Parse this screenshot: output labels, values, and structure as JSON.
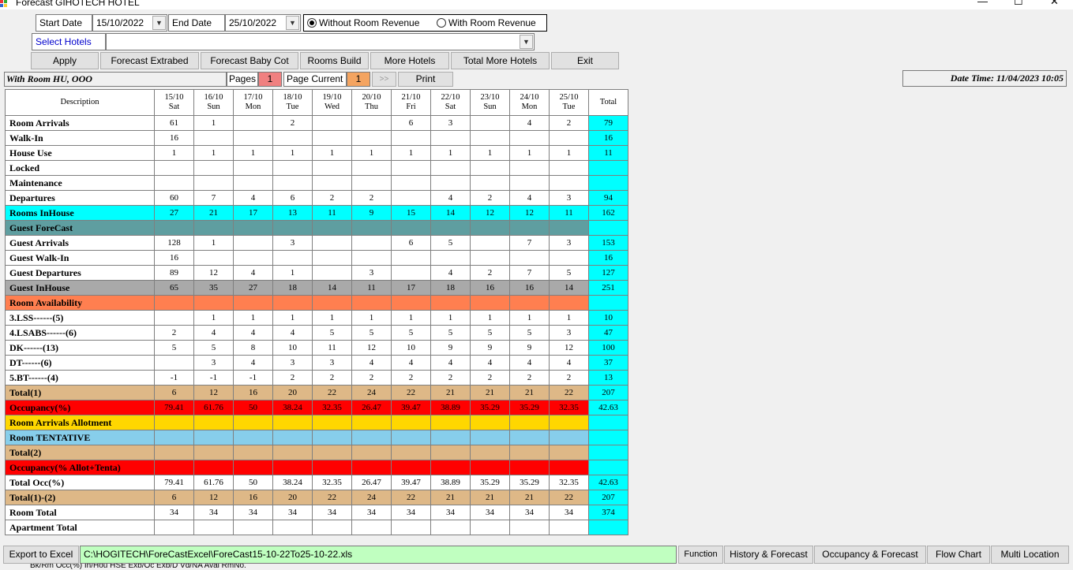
{
  "window": {
    "title": "Forecast GIHOTECH HOTEL",
    "minimize": "—",
    "maximize": "☐",
    "close": "✕"
  },
  "filters": {
    "start_label": "Start Date",
    "start_value": "15/10/2022",
    "end_label": "End Date",
    "end_value": "25/10/2022",
    "radio_without": "Without Room Revenue",
    "radio_with": "With Room Revenue",
    "select_hotels_label": "Select Hotels",
    "select_hotels_value": ""
  },
  "buttons": {
    "apply": "Apply",
    "forecast_extrabed": "Forecast Extrabed",
    "forecast_babycot": "Forecast Baby Cot",
    "rooms_build": "Rooms Build",
    "more_hotels": "More Hotels",
    "total_more_hotels": "Total More Hotels",
    "exit": "Exit"
  },
  "infobar": {
    "mode": "With Room HU, OOO",
    "pages_label": "Pages",
    "pages_value": "1",
    "page_current_label": "Page Current",
    "page_current_value": "1",
    "next": ">>",
    "print": "Print",
    "datetime": "Date Time: 11/04/2023 10:05"
  },
  "table": {
    "desc_header": "Description",
    "columns": [
      {
        "date": "15/10",
        "day": "Sat"
      },
      {
        "date": "16/10",
        "day": "Sun"
      },
      {
        "date": "17/10",
        "day": "Mon"
      },
      {
        "date": "18/10",
        "day": "Tue"
      },
      {
        "date": "19/10",
        "day": "Wed"
      },
      {
        "date": "20/10",
        "day": "Thu"
      },
      {
        "date": "21/10",
        "day": "Fri"
      },
      {
        "date": "22/10",
        "day": "Sat"
      },
      {
        "date": "23/10",
        "day": "Sun"
      },
      {
        "date": "24/10",
        "day": "Mon"
      },
      {
        "date": "25/10",
        "day": "Tue"
      }
    ],
    "total_header": "Total",
    "rows": [
      {
        "label": "Room Arrivals",
        "style": "",
        "values": [
          "61",
          "1",
          "",
          "2",
          "",
          "",
          "6",
          "3",
          "",
          "4",
          "2"
        ],
        "total": "79"
      },
      {
        "label": "Walk-In",
        "style": "",
        "values": [
          "16",
          "",
          "",
          "",
          "",
          "",
          "",
          "",
          "",
          "",
          ""
        ],
        "total": "16"
      },
      {
        "label": "House Use",
        "style": "",
        "values": [
          "1",
          "1",
          "1",
          "1",
          "1",
          "1",
          "1",
          "1",
          "1",
          "1",
          "1"
        ],
        "total": "11"
      },
      {
        "label": "Locked",
        "style": "",
        "values": [
          "",
          "",
          "",
          "",
          "",
          "",
          "",
          "",
          "",
          "",
          ""
        ],
        "total": ""
      },
      {
        "label": "Maintenance",
        "style": "",
        "values": [
          "",
          "",
          "",
          "",
          "",
          "",
          "",
          "",
          "",
          "",
          ""
        ],
        "total": ""
      },
      {
        "label": "Departures",
        "style": "",
        "values": [
          "60",
          "7",
          "4",
          "6",
          "2",
          "2",
          "",
          "4",
          "2",
          "4",
          "3"
        ],
        "total": "94"
      },
      {
        "label": "Rooms InHouse",
        "style": "cyan",
        "values": [
          "27",
          "21",
          "17",
          "13",
          "11",
          "9",
          "15",
          "14",
          "12",
          "12",
          "11"
        ],
        "total": "162"
      },
      {
        "label": "Guest ForeCast",
        "style": "teal",
        "values": [
          "",
          "",
          "",
          "",
          "",
          "",
          "",
          "",
          "",
          "",
          ""
        ],
        "total": ""
      },
      {
        "label": "Guest Arrivals",
        "style": "",
        "values": [
          "128",
          "1",
          "",
          "3",
          "",
          "",
          "6",
          "5",
          "",
          "7",
          "3"
        ],
        "total": "153"
      },
      {
        "label": "Guest Walk-In",
        "style": "",
        "values": [
          "16",
          "",
          "",
          "",
          "",
          "",
          "",
          "",
          "",
          "",
          ""
        ],
        "total": "16"
      },
      {
        "label": "Guest Departures",
        "style": "",
        "values": [
          "89",
          "12",
          "4",
          "1",
          "",
          "3",
          "",
          "4",
          "2",
          "7",
          "5"
        ],
        "total": "127"
      },
      {
        "label": "Guest InHouse",
        "style": "gray",
        "values": [
          "65",
          "35",
          "27",
          "18",
          "14",
          "11",
          "17",
          "18",
          "16",
          "16",
          "14"
        ],
        "total": "251"
      },
      {
        "label": "Room Availability",
        "style": "coral",
        "values": [
          "",
          "",
          "",
          "",
          "",
          "",
          "",
          "",
          "",
          "",
          ""
        ],
        "total": ""
      },
      {
        "label": "3.LSS------(5)",
        "style": "",
        "values": [
          "",
          "1",
          "1",
          "1",
          "1",
          "1",
          "1",
          "1",
          "1",
          "1",
          "1"
        ],
        "total": "10"
      },
      {
        "label": "4.LSABS------(6)",
        "style": "",
        "values": [
          "2",
          "4",
          "4",
          "4",
          "5",
          "5",
          "5",
          "5",
          "5",
          "5",
          "3"
        ],
        "total": "47"
      },
      {
        "label": "DK------(13)",
        "style": "",
        "values": [
          "5",
          "5",
          "8",
          "10",
          "11",
          "12",
          "10",
          "9",
          "9",
          "9",
          "12"
        ],
        "total": "100"
      },
      {
        "label": "DT------(6)",
        "style": "",
        "values": [
          "",
          "3",
          "4",
          "3",
          "3",
          "4",
          "4",
          "4",
          "4",
          "4",
          "4"
        ],
        "total": "37"
      },
      {
        "label": "5.BT------(4)",
        "style": "",
        "values": [
          "-1",
          "-1",
          "-1",
          "2",
          "2",
          "2",
          "2",
          "2",
          "2",
          "2",
          "2"
        ],
        "total": "13"
      },
      {
        "label": "Total(1)",
        "style": "tan",
        "values": [
          "6",
          "12",
          "16",
          "20",
          "22",
          "24",
          "22",
          "21",
          "21",
          "21",
          "22"
        ],
        "total": "207"
      },
      {
        "label": "Occupancy(%)",
        "style": "red",
        "values": [
          "79.41",
          "61.76",
          "50",
          "38.24",
          "32.35",
          "26.47",
          "39.47",
          "38.89",
          "35.29",
          "35.29",
          "32.35"
        ],
        "total": "42.63"
      },
      {
        "label": "Room Arrivals Allotment",
        "style": "gold",
        "values": [
          "",
          "",
          "",
          "",
          "",
          "",
          "",
          "",
          "",
          "",
          ""
        ],
        "total": ""
      },
      {
        "label": "Room TENTATIVE",
        "style": "sky",
        "values": [
          "",
          "",
          "",
          "",
          "",
          "",
          "",
          "",
          "",
          "",
          ""
        ],
        "total": ""
      },
      {
        "label": "Total(2)",
        "style": "tan",
        "values": [
          "",
          "",
          "",
          "",
          "",
          "",
          "",
          "",
          "",
          "",
          ""
        ],
        "total": ""
      },
      {
        "label": "Occupancy(% Allot+Tenta)",
        "style": "red",
        "values": [
          "",
          "",
          "",
          "",
          "",
          "",
          "",
          "",
          "",
          "",
          ""
        ],
        "total": ""
      },
      {
        "label": "Total Occ(%)",
        "style": "",
        "values": [
          "79.41",
          "61.76",
          "50",
          "38.24",
          "32.35",
          "26.47",
          "39.47",
          "38.89",
          "35.29",
          "35.29",
          "32.35"
        ],
        "total": "42.63"
      },
      {
        "label": "Total(1)-(2)",
        "style": "tan",
        "values": [
          "6",
          "12",
          "16",
          "20",
          "22",
          "24",
          "22",
          "21",
          "21",
          "21",
          "22"
        ],
        "total": "207"
      },
      {
        "label": "Room Total",
        "style": "",
        "values": [
          "34",
          "34",
          "34",
          "34",
          "34",
          "34",
          "34",
          "34",
          "34",
          "34",
          "34"
        ],
        "total": "374"
      },
      {
        "label": "Apartment Total",
        "style": "",
        "values": [
          "",
          "",
          "",
          "",
          "",
          "",
          "",
          "",
          "",
          "",
          ""
        ],
        "total": ""
      }
    ]
  },
  "statusbar": {
    "export": "Export to Excel",
    "path": "C:\\HOGITECH\\ForeCastExcel\\ForeCast15-10-22To25-10-22.xls",
    "tabs": [
      "Function",
      "History & Forecast",
      "Occupancy & Forecast",
      "Flow Chart",
      "Multi Location"
    ]
  },
  "clipped_row": "Bk/Rm  Occ(%)  In/Hou   HSE   Exb/Oc  Exb/D   Vd/NA    Avai   RmNo."
}
